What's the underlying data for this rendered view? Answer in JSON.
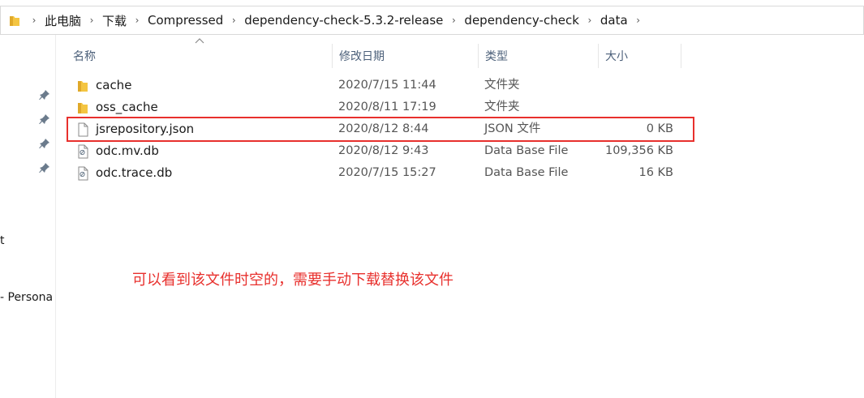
{
  "breadcrumb": [
    "此电脑",
    "下载",
    "Compressed",
    "dependency-check-5.3.2-release",
    "dependency-check",
    "data"
  ],
  "columns": {
    "name": "名称",
    "date": "修改日期",
    "type": "类型",
    "size": "大小"
  },
  "files": [
    {
      "icon": "folder-icon",
      "name": "cache",
      "date": "2020/7/15 11:44",
      "type": "文件夹",
      "size": ""
    },
    {
      "icon": "folder-icon",
      "name": "oss_cache",
      "date": "2020/8/11 17:19",
      "type": "文件夹",
      "size": ""
    },
    {
      "icon": "file-icon",
      "name": "jsrepository.json",
      "date": "2020/8/12 8:44",
      "type": "JSON 文件",
      "size": "0 KB"
    },
    {
      "icon": "db-file-icon",
      "name": "odc.mv.db",
      "date": "2020/8/12 9:43",
      "type": "Data Base File",
      "size": "109,356 KB"
    },
    {
      "icon": "db-file-icon",
      "name": "odc.trace.db",
      "date": "2020/7/15 15:27",
      "type": "Data Base File",
      "size": "16 KB"
    }
  ],
  "nav_fragments": [
    "t",
    "- Persona"
  ],
  "annotation": "可以看到该文件时空的，需要手动下载替换该文件",
  "colors": {
    "highlight": "#e8302d",
    "annotation": "#e8302d",
    "folder": "#f4c542",
    "header_text": "#4c607a"
  }
}
